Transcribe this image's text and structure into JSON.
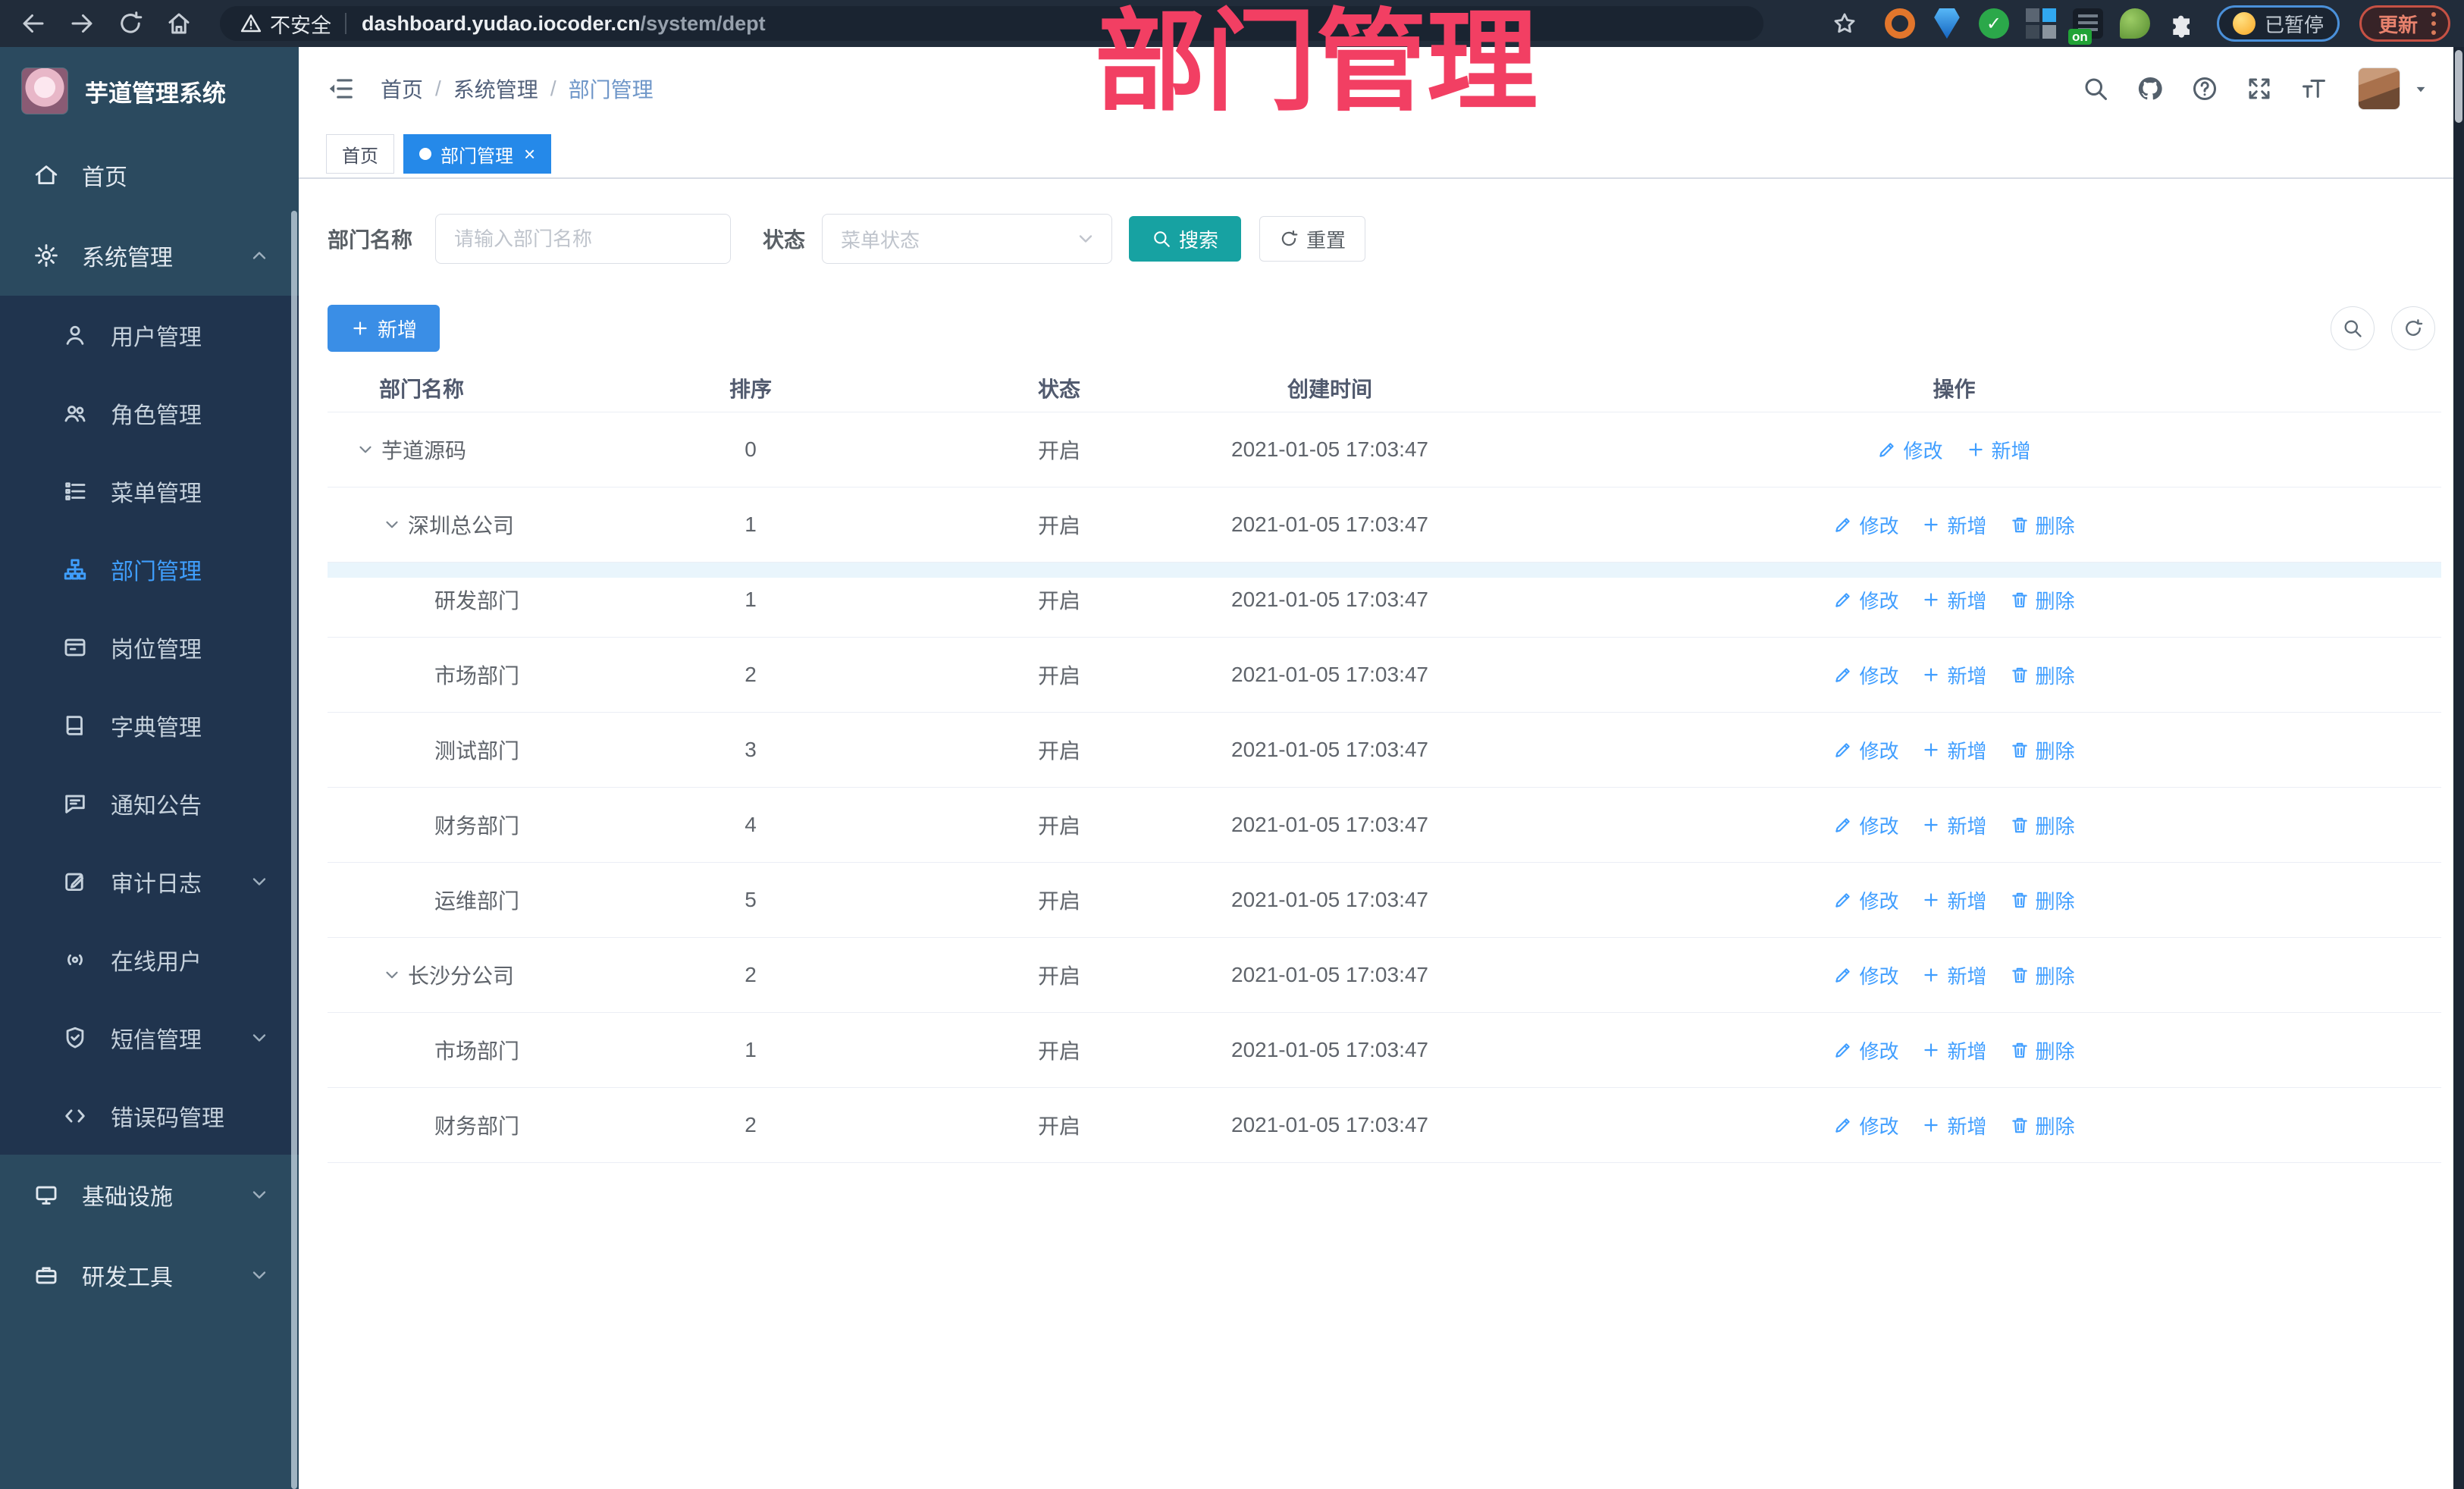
{
  "watermark": "部门管理",
  "colors": {
    "primary_blue": "#409EFF",
    "add_button_blue": "#3A8EE6",
    "search_teal": "#17A2A2",
    "active_tab_blue": "#2589E9",
    "watermark_pink": "#F23F63",
    "sidebar_bg": "#2B4A5F",
    "submenu_bg": "#20344E"
  },
  "browser": {
    "security_label": "不安全",
    "url_host": "dashboard.yudao.iocoder.cn",
    "url_path": "/system/dept",
    "extension_on_badge": "on",
    "paused_badge": "已暂停",
    "update_label": "更新"
  },
  "sidebar": {
    "title": "芋道管理系统",
    "items": [
      {
        "label": "首页",
        "icon": "home-icon"
      },
      {
        "label": "系统管理",
        "icon": "gear-icon",
        "expanded": true
      },
      {
        "label": "用户管理",
        "icon": "user-icon"
      },
      {
        "label": "角色管理",
        "icon": "users-icon"
      },
      {
        "label": "菜单管理",
        "icon": "menu-list-icon"
      },
      {
        "label": "部门管理",
        "icon": "org-tree-icon",
        "active": true
      },
      {
        "label": "岗位管理",
        "icon": "badge-icon"
      },
      {
        "label": "字典管理",
        "icon": "book-icon"
      },
      {
        "label": "通知公告",
        "icon": "comment-icon"
      },
      {
        "label": "审计日志",
        "icon": "edit-square-icon",
        "collapsible": true
      },
      {
        "label": "在线用户",
        "icon": "online-icon"
      },
      {
        "label": "短信管理",
        "icon": "shield-check-icon",
        "collapsible": true
      },
      {
        "label": "错误码管理",
        "icon": "code-icon"
      },
      {
        "label": "基础设施",
        "icon": "monitor-icon",
        "collapsible": true
      },
      {
        "label": "研发工具",
        "icon": "toolbox-icon",
        "collapsible": true
      }
    ]
  },
  "header": {
    "breadcrumb": [
      "首页",
      "系统管理",
      "部门管理"
    ]
  },
  "tabs": [
    {
      "label": "首页",
      "active": false
    },
    {
      "label": "部门管理",
      "active": true,
      "closable": true
    }
  ],
  "filters": {
    "name_label": "部门名称",
    "name_placeholder": "请输入部门名称",
    "name_value": "",
    "status_label": "状态",
    "status_placeholder": "菜单状态",
    "search_label": "搜索",
    "reset_label": "重置"
  },
  "toolbar": {
    "add_label": "新增"
  },
  "table": {
    "columns": [
      "部门名称",
      "排序",
      "状态",
      "创建时间",
      "操作"
    ],
    "action_labels": {
      "edit": "修改",
      "add": "新增",
      "delete": "删除"
    },
    "rows": [
      {
        "name": "芋道源码",
        "level": 0,
        "expandable": true,
        "sort": "0",
        "status": "开启",
        "created": "2021-01-05 17:03:47",
        "actions": [
          "edit",
          "add"
        ]
      },
      {
        "name": "深圳总公司",
        "level": 1,
        "expandable": true,
        "sort": "1",
        "status": "开启",
        "created": "2021-01-05 17:03:47",
        "actions": [
          "edit",
          "add",
          "delete"
        ]
      },
      {
        "name": "研发部门",
        "level": 2,
        "expandable": false,
        "sort": "1",
        "status": "开启",
        "created": "2021-01-05 17:03:47",
        "actions": [
          "edit",
          "add",
          "delete"
        ],
        "hover_strip": true
      },
      {
        "name": "市场部门",
        "level": 2,
        "expandable": false,
        "sort": "2",
        "status": "开启",
        "created": "2021-01-05 17:03:47",
        "actions": [
          "edit",
          "add",
          "delete"
        ]
      },
      {
        "name": "测试部门",
        "level": 2,
        "expandable": false,
        "sort": "3",
        "status": "开启",
        "created": "2021-01-05 17:03:47",
        "actions": [
          "edit",
          "add",
          "delete"
        ]
      },
      {
        "name": "财务部门",
        "level": 2,
        "expandable": false,
        "sort": "4",
        "status": "开启",
        "created": "2021-01-05 17:03:47",
        "actions": [
          "edit",
          "add",
          "delete"
        ]
      },
      {
        "name": "运维部门",
        "level": 2,
        "expandable": false,
        "sort": "5",
        "status": "开启",
        "created": "2021-01-05 17:03:47",
        "actions": [
          "edit",
          "add",
          "delete"
        ]
      },
      {
        "name": "长沙分公司",
        "level": 1,
        "expandable": true,
        "sort": "2",
        "status": "开启",
        "created": "2021-01-05 17:03:47",
        "actions": [
          "edit",
          "add",
          "delete"
        ]
      },
      {
        "name": "市场部门",
        "level": 2,
        "expandable": false,
        "sort": "1",
        "status": "开启",
        "created": "2021-01-05 17:03:47",
        "actions": [
          "edit",
          "add",
          "delete"
        ]
      },
      {
        "name": "财务部门",
        "level": 2,
        "expandable": false,
        "sort": "2",
        "status": "开启",
        "created": "2021-01-05 17:03:47",
        "actions": [
          "edit",
          "add",
          "delete"
        ]
      }
    ]
  }
}
